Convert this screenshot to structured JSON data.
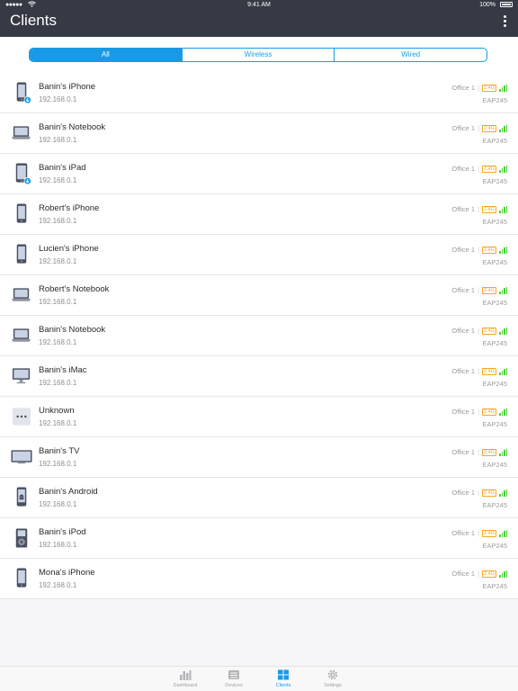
{
  "status_bar": {
    "time": "9:41 AM",
    "battery": "100%"
  },
  "header": {
    "title": "Clients"
  },
  "filter": {
    "options": [
      "All",
      "Wireless",
      "Wired"
    ],
    "selected": "All"
  },
  "colors": {
    "accent": "#1a9ae4",
    "header_bg": "#363a45",
    "band": "#f5a623",
    "signal": "#4cd137"
  },
  "clients": [
    {
      "name": "Banin's iPhone",
      "ip": "192.168.0.1",
      "location": "Office 1",
      "band": "2.4G",
      "signal_bars": 4,
      "model": "EAP245",
      "icon": "iphone-icon",
      "download": true
    },
    {
      "name": "Banin's Notebook",
      "ip": "192.168.0.1",
      "location": "Office 1",
      "band": "2.4G",
      "signal_bars": 4,
      "model": "EAP245",
      "icon": "laptop-icon"
    },
    {
      "name": "Banin's iPad",
      "ip": "192.168.0.1",
      "location": "Office 1",
      "band": "2.4G",
      "signal_bars": 4,
      "model": "EAP245",
      "icon": "ipad-icon",
      "download": true
    },
    {
      "name": "Robert's iPhone",
      "ip": "192.168.0.1",
      "location": "Office 1",
      "band": "2.4G",
      "signal_bars": 4,
      "model": "EAP245",
      "icon": "iphone-icon"
    },
    {
      "name": "Lucien's iPhone",
      "ip": "192.168.0.1",
      "location": "Office 1",
      "band": "2.4G",
      "signal_bars": 4,
      "model": "EAP245",
      "icon": "iphone-icon"
    },
    {
      "name": "Robert's Notebook",
      "ip": "192.168.0.1",
      "location": "Office 1",
      "band": "2.4G",
      "signal_bars": 4,
      "model": "EAP245",
      "icon": "laptop-icon"
    },
    {
      "name": "Banin's Notebook",
      "ip": "192.168.0.1",
      "location": "Office 1",
      "band": "2.4G",
      "signal_bars": 4,
      "model": "EAP245",
      "icon": "laptop-icon"
    },
    {
      "name": "Banin's iMac",
      "ip": "192.168.0.1",
      "location": "Office 1",
      "band": "2.4G",
      "signal_bars": 4,
      "model": "EAP245",
      "icon": "imac-icon"
    },
    {
      "name": "Unknown",
      "ip": "192.168.0.1",
      "location": "Office 1",
      "band": "2.4G",
      "signal_bars": 4,
      "model": "EAP245",
      "icon": "unknown-device-icon"
    },
    {
      "name": "Banin's TV",
      "ip": "192.168.0.1",
      "location": "Office 1",
      "band": "2.4G",
      "signal_bars": 4,
      "model": "EAP245",
      "icon": "tv-icon"
    },
    {
      "name": "Banin's Android",
      "ip": "192.168.0.1",
      "location": "Office 1",
      "band": "2.4G",
      "signal_bars": 4,
      "model": "EAP245",
      "icon": "android-phone-icon"
    },
    {
      "name": "Banin's iPod",
      "ip": "192.168.0.1",
      "location": "Office 1",
      "band": "2.4G",
      "signal_bars": 4,
      "model": "EAP245",
      "icon": "ipod-icon"
    },
    {
      "name": "Mona's iPhone",
      "ip": "192.168.0.1",
      "location": "Office 1",
      "band": "2.4G",
      "signal_bars": 4,
      "model": "EAP245",
      "icon": "iphone-icon"
    }
  ],
  "tabbar": {
    "tabs": [
      {
        "label": "Dashboard",
        "icon": "bar-chart-icon"
      },
      {
        "label": "Devices",
        "icon": "devices-icon"
      },
      {
        "label": "Clients",
        "icon": "grid-icon"
      },
      {
        "label": "Settings",
        "icon": "gear-icon"
      }
    ],
    "selected": "Clients"
  }
}
